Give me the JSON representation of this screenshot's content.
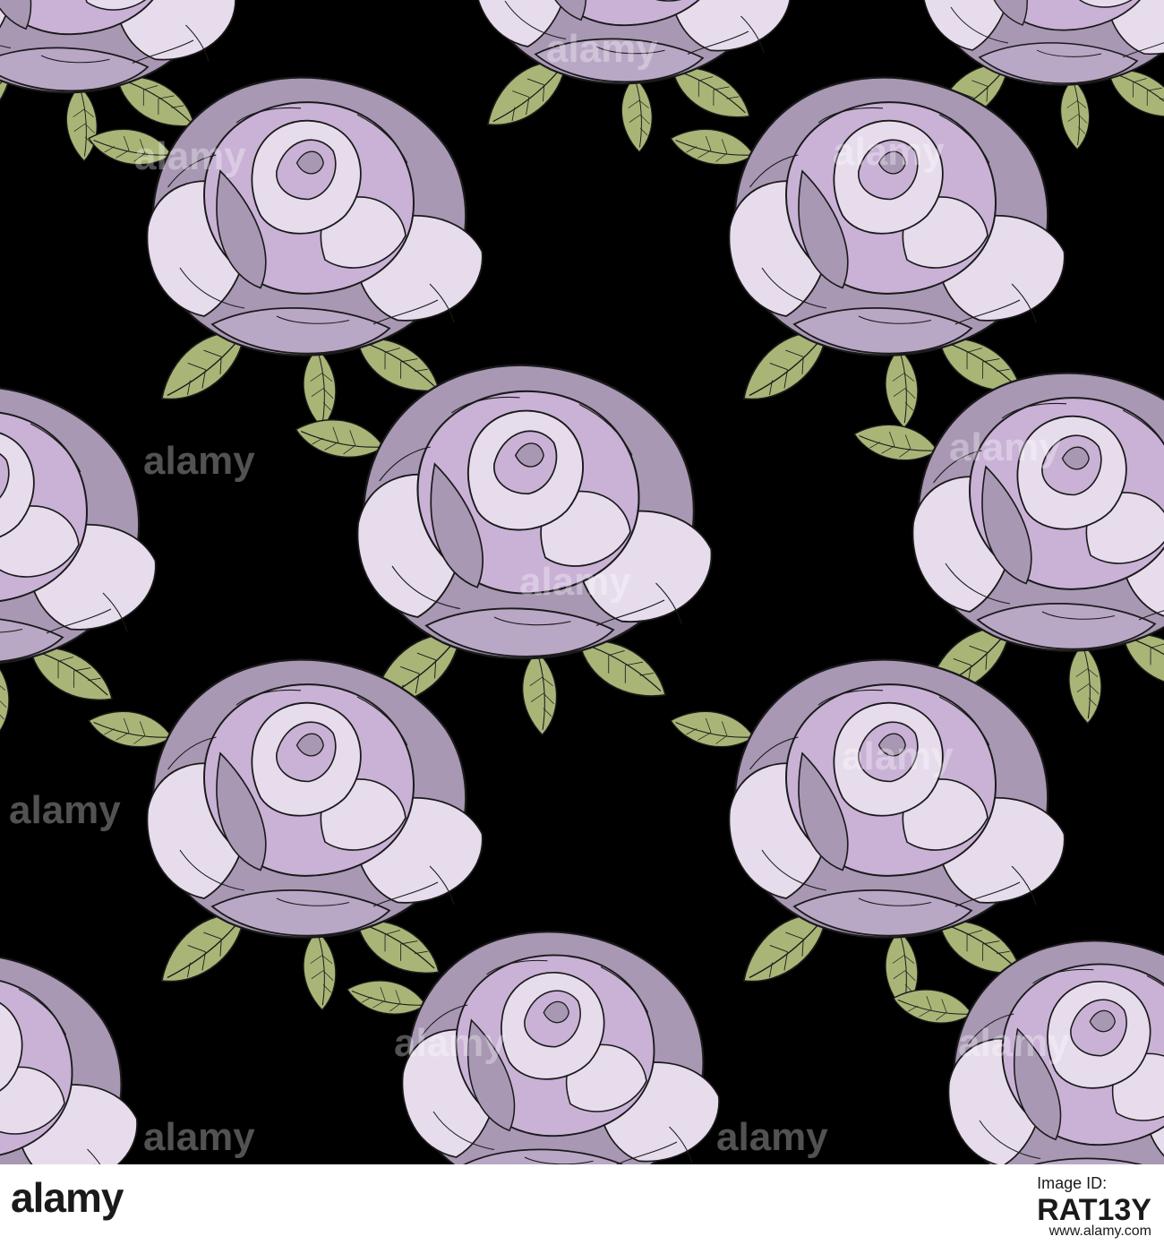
{
  "watermark": {
    "text": "alamy"
  },
  "footer": {
    "logo": "alamy",
    "image_id_label": "Image ID:",
    "image_id": "RAT13Y",
    "url": "www.alamy.com"
  },
  "colors": {
    "background": "#000000",
    "petal_light": "#e7dcec",
    "petal_mid": "#c9b2d6",
    "petal_dark": "#a898b4",
    "leaf_light": "#b8c48a",
    "leaf_dark": "#8f9c5e",
    "footer_bg": "#ffffff"
  }
}
